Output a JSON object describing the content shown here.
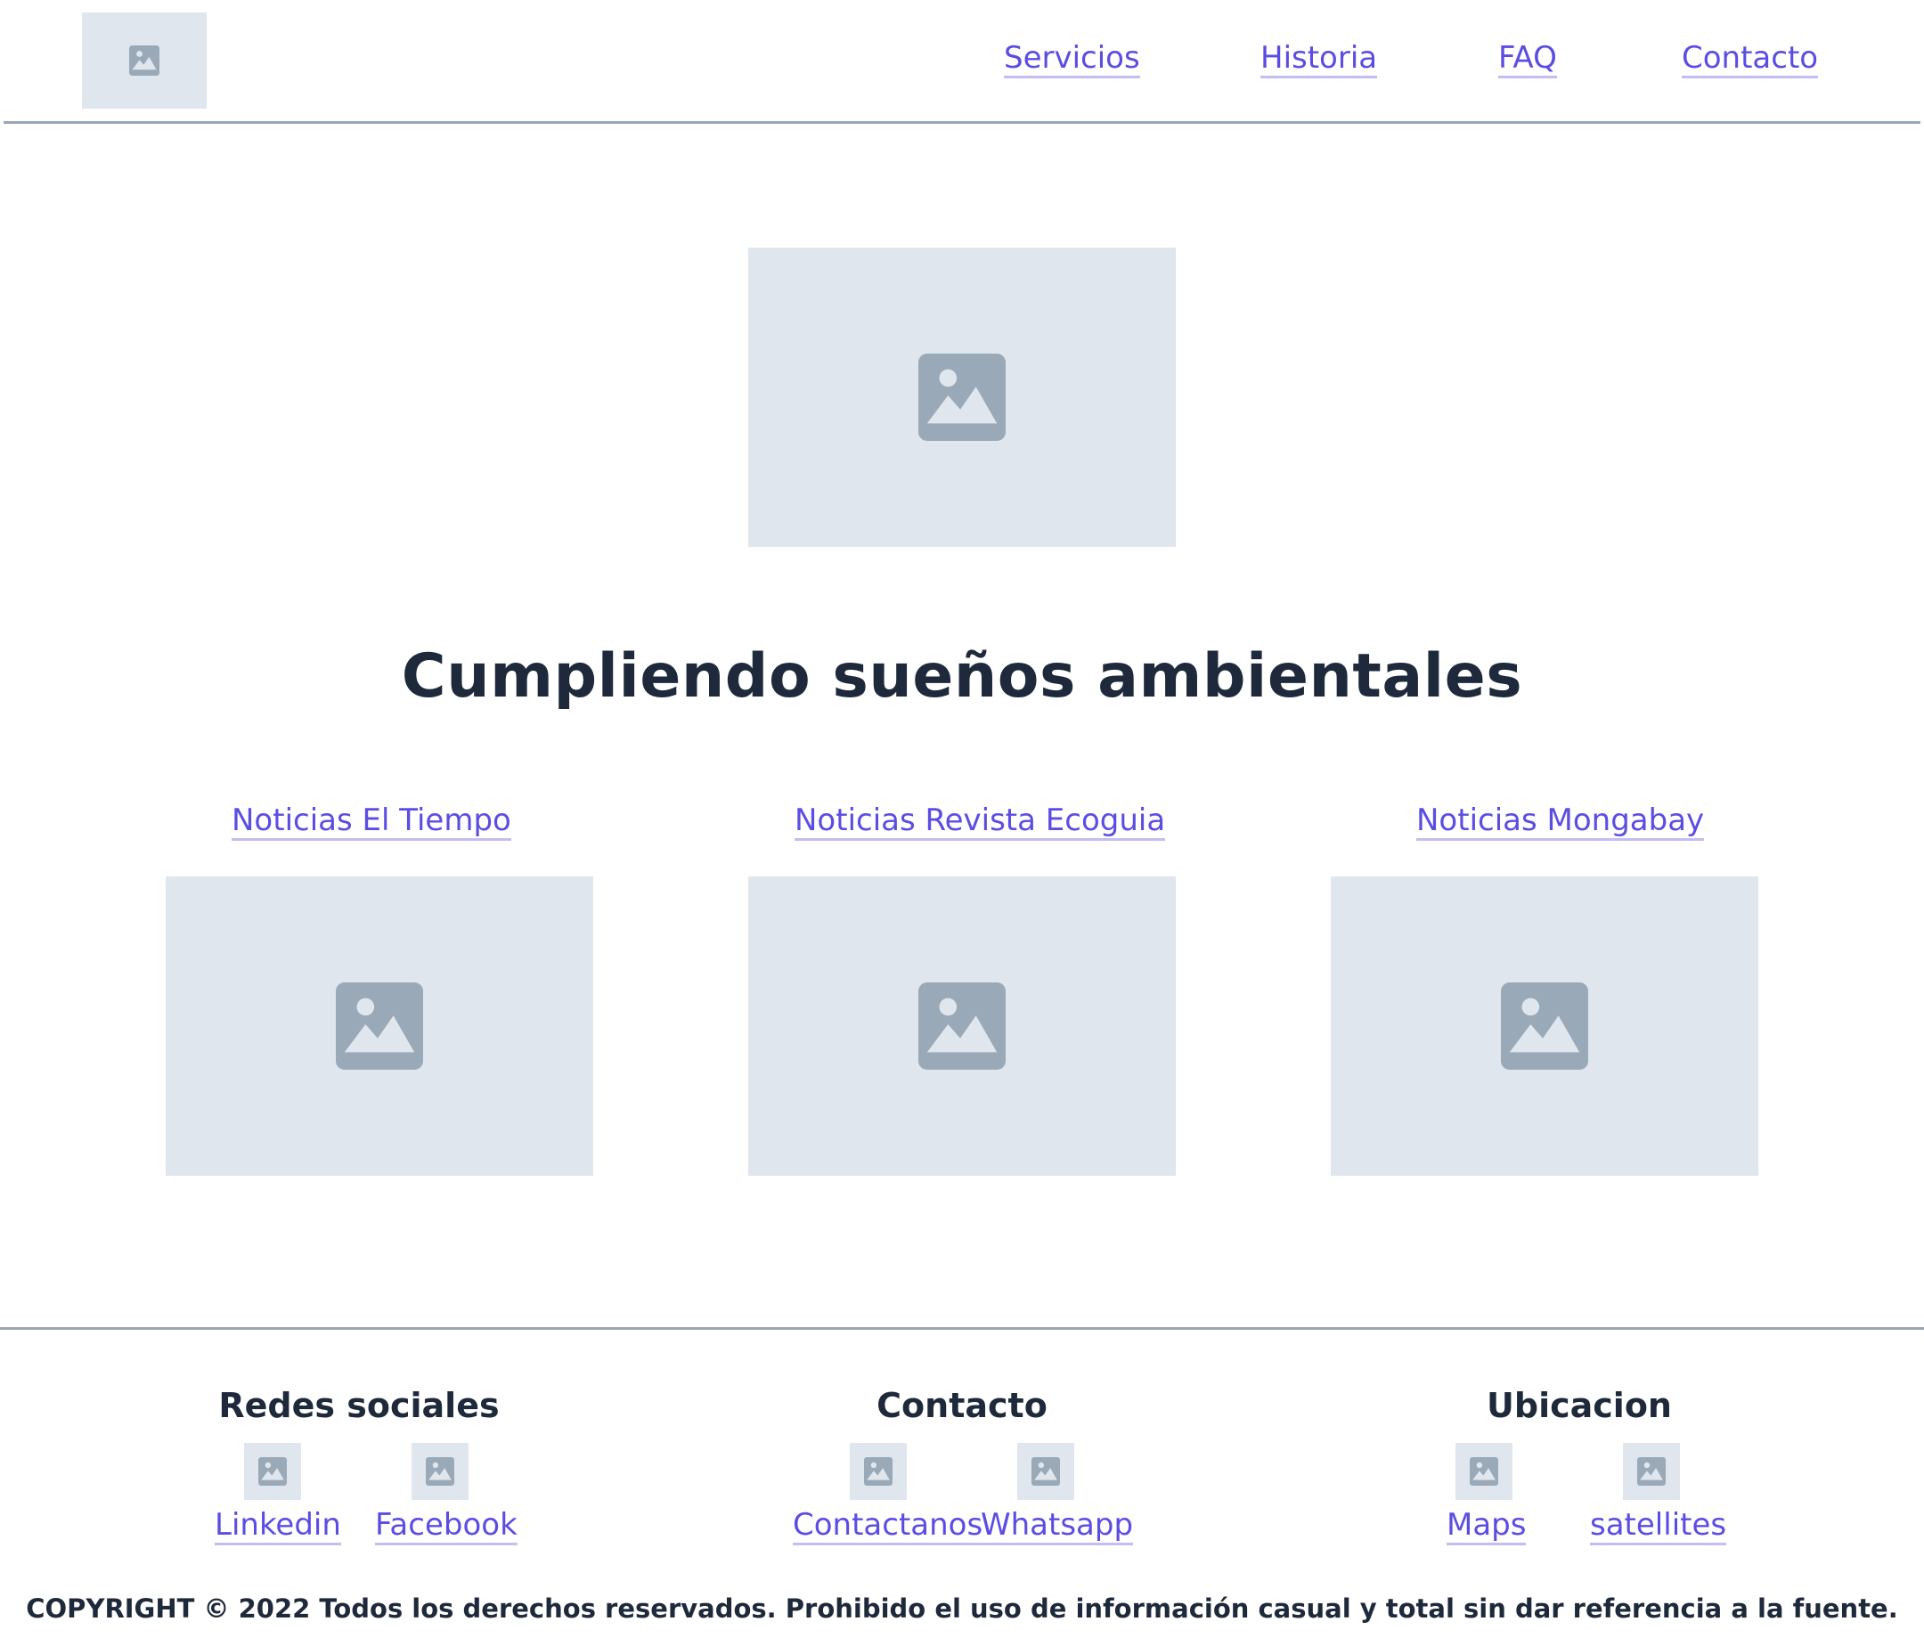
{
  "header": {
    "logo_icon": "image-placeholder-icon",
    "nav": [
      "Servicios",
      "Historia",
      "FAQ",
      "Contacto"
    ]
  },
  "hero": {
    "image_icon": "image-placeholder-icon",
    "title": "Cumpliendo sueños ambientales"
  },
  "news": [
    {
      "label": "Noticias El Tiempo",
      "image_icon": "image-placeholder-icon"
    },
    {
      "label": "Noticias Revista Ecoguia",
      "image_icon": "image-placeholder-icon"
    },
    {
      "label": "Noticias Mongabay",
      "image_icon": "image-placeholder-icon"
    }
  ],
  "footer": {
    "columns": [
      {
        "title": "Redes sociales",
        "links": [
          "Linkedin",
          "Facebook"
        ]
      },
      {
        "title": "Contacto",
        "links": [
          "Contactanos",
          "Whatsapp"
        ]
      },
      {
        "title": "Ubicacion",
        "links": [
          "Maps",
          "satellites"
        ]
      }
    ],
    "copyright": "COPYRIGHT © 2022 Todos los derechos reservados. Prohibido el uso de información casual y total sin dar referencia a la fuente."
  },
  "colors": {
    "link": "#5b4de3",
    "link_underline": "#c3bdf3",
    "placeholder_bg": "#e0e6ee",
    "placeholder_icon": "#9aa9b7",
    "heading": "#1e2a3b",
    "divider": "#9aa6b4"
  }
}
